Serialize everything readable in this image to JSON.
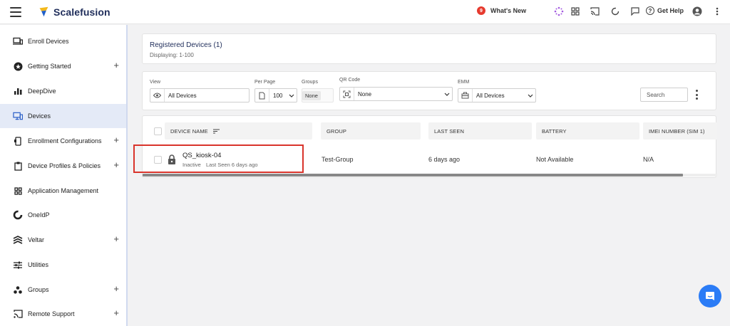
{
  "header": {
    "brand": "Scalefusion",
    "whats_new": "What's New",
    "whats_new_badge": "9",
    "get_help": "Get Help",
    "help_glyph": "?"
  },
  "sidebar": {
    "items": [
      {
        "label": "Enroll Devices",
        "icon": "laptop-phone-icon",
        "plus": false
      },
      {
        "label": "Getting Started",
        "icon": "star-badge-icon",
        "plus": true
      },
      {
        "label": "DeepDive",
        "icon": "bar-chart-icon",
        "plus": false
      },
      {
        "label": "Devices",
        "icon": "devices-icon",
        "plus": false,
        "active": true
      },
      {
        "label": "Enrollment Configurations",
        "icon": "phone-config-icon",
        "plus": true
      },
      {
        "label": "Device Profiles & Policies",
        "icon": "clipboard-icon",
        "plus": true
      },
      {
        "label": "Application Management",
        "icon": "apps-grid-icon",
        "plus": false
      },
      {
        "label": "OneIdP",
        "icon": "oneidp-icon",
        "plus": false
      },
      {
        "label": "Veltar",
        "icon": "veltar-icon",
        "plus": true
      },
      {
        "label": "Utilities",
        "icon": "sliders-icon",
        "plus": false
      },
      {
        "label": "Groups",
        "icon": "groups-icon",
        "plus": true
      },
      {
        "label": "Remote Support",
        "icon": "cast-icon",
        "plus": true
      }
    ],
    "plus_glyph": "+"
  },
  "main": {
    "title": "Registered Devices (1)",
    "subtitle": "Displaying: 1-100",
    "filters": {
      "view_label": "View",
      "view_value": "All Devices",
      "per_page_label": "Per Page",
      "per_page_value": "100",
      "groups_label": "Groups",
      "groups_value": "None",
      "qr_label": "QR Code",
      "qr_value": "None",
      "emm_label": "EMM",
      "emm_value": "All Devices",
      "search_placeholder": "Search"
    },
    "table": {
      "columns": [
        "DEVICE NAME",
        "GROUP",
        "LAST SEEN",
        "BATTERY",
        "IMEI NUMBER (SIM 1)"
      ],
      "rows": [
        {
          "device_name": "QS_kiosk-04",
          "status": "Inactive",
          "last_seen_sub": "Last Seen 6 days ago",
          "group": "Test-Group",
          "last_seen": "6 days ago",
          "battery": "Not Available",
          "imei": "N/A"
        }
      ]
    }
  },
  "colors": {
    "brand": "#1f2d5a",
    "active_nav": "#e4eaf7",
    "highlight": "#d9342b",
    "chat": "#2b7cf6"
  }
}
